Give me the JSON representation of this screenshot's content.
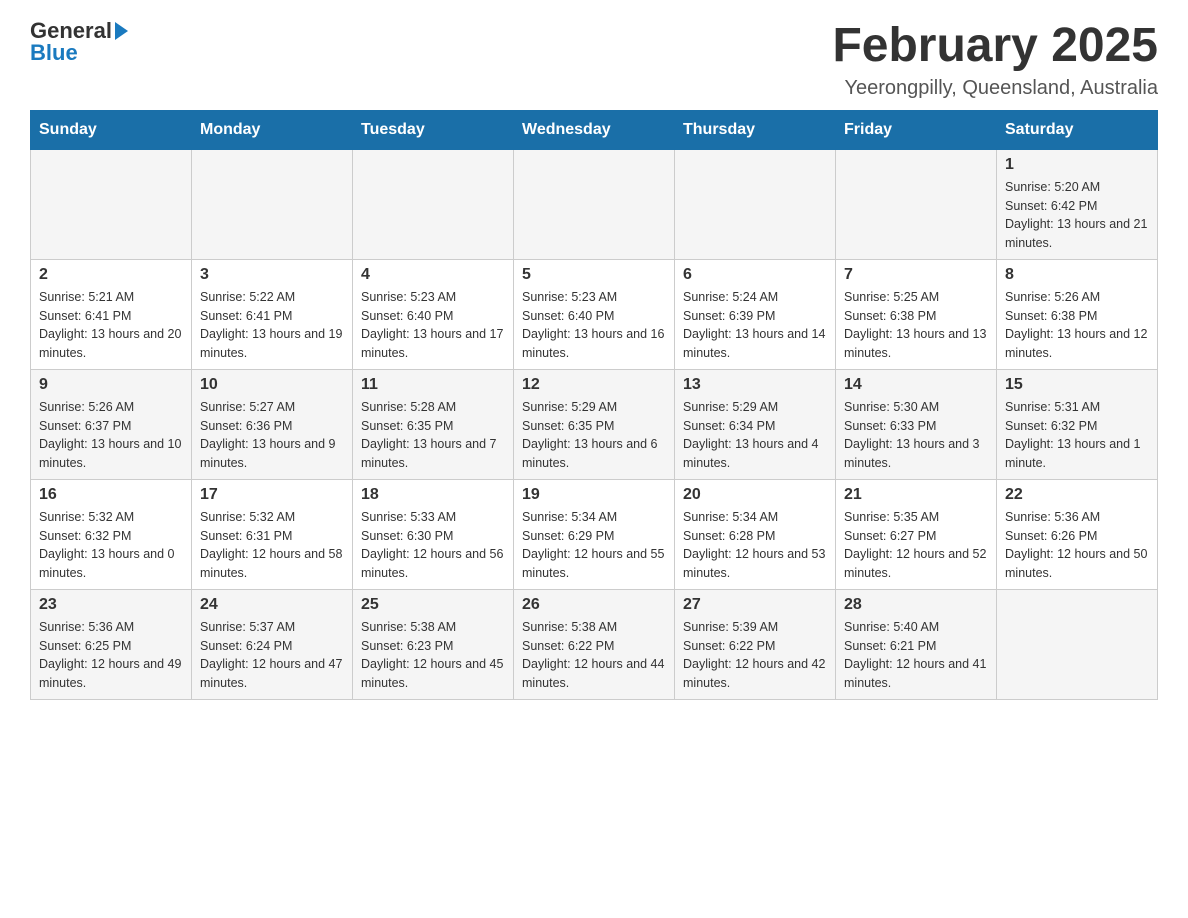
{
  "header": {
    "logo": {
      "general": "General",
      "blue": "Blue"
    },
    "title": "February 2025",
    "location": "Yeerongpilly, Queensland, Australia"
  },
  "days_of_week": [
    "Sunday",
    "Monday",
    "Tuesday",
    "Wednesday",
    "Thursday",
    "Friday",
    "Saturday"
  ],
  "weeks": [
    {
      "row": 1,
      "days": [
        {
          "date": "",
          "info": ""
        },
        {
          "date": "",
          "info": ""
        },
        {
          "date": "",
          "info": ""
        },
        {
          "date": "",
          "info": ""
        },
        {
          "date": "",
          "info": ""
        },
        {
          "date": "",
          "info": ""
        },
        {
          "date": "1",
          "info": "Sunrise: 5:20 AM\nSunset: 6:42 PM\nDaylight: 13 hours and 21 minutes."
        }
      ]
    },
    {
      "row": 2,
      "days": [
        {
          "date": "2",
          "info": "Sunrise: 5:21 AM\nSunset: 6:41 PM\nDaylight: 13 hours and 20 minutes."
        },
        {
          "date": "3",
          "info": "Sunrise: 5:22 AM\nSunset: 6:41 PM\nDaylight: 13 hours and 19 minutes."
        },
        {
          "date": "4",
          "info": "Sunrise: 5:23 AM\nSunset: 6:40 PM\nDaylight: 13 hours and 17 minutes."
        },
        {
          "date": "5",
          "info": "Sunrise: 5:23 AM\nSunset: 6:40 PM\nDaylight: 13 hours and 16 minutes."
        },
        {
          "date": "6",
          "info": "Sunrise: 5:24 AM\nSunset: 6:39 PM\nDaylight: 13 hours and 14 minutes."
        },
        {
          "date": "7",
          "info": "Sunrise: 5:25 AM\nSunset: 6:38 PM\nDaylight: 13 hours and 13 minutes."
        },
        {
          "date": "8",
          "info": "Sunrise: 5:26 AM\nSunset: 6:38 PM\nDaylight: 13 hours and 12 minutes."
        }
      ]
    },
    {
      "row": 3,
      "days": [
        {
          "date": "9",
          "info": "Sunrise: 5:26 AM\nSunset: 6:37 PM\nDaylight: 13 hours and 10 minutes."
        },
        {
          "date": "10",
          "info": "Sunrise: 5:27 AM\nSunset: 6:36 PM\nDaylight: 13 hours and 9 minutes."
        },
        {
          "date": "11",
          "info": "Sunrise: 5:28 AM\nSunset: 6:35 PM\nDaylight: 13 hours and 7 minutes."
        },
        {
          "date": "12",
          "info": "Sunrise: 5:29 AM\nSunset: 6:35 PM\nDaylight: 13 hours and 6 minutes."
        },
        {
          "date": "13",
          "info": "Sunrise: 5:29 AM\nSunset: 6:34 PM\nDaylight: 13 hours and 4 minutes."
        },
        {
          "date": "14",
          "info": "Sunrise: 5:30 AM\nSunset: 6:33 PM\nDaylight: 13 hours and 3 minutes."
        },
        {
          "date": "15",
          "info": "Sunrise: 5:31 AM\nSunset: 6:32 PM\nDaylight: 13 hours and 1 minute."
        }
      ]
    },
    {
      "row": 4,
      "days": [
        {
          "date": "16",
          "info": "Sunrise: 5:32 AM\nSunset: 6:32 PM\nDaylight: 13 hours and 0 minutes."
        },
        {
          "date": "17",
          "info": "Sunrise: 5:32 AM\nSunset: 6:31 PM\nDaylight: 12 hours and 58 minutes."
        },
        {
          "date": "18",
          "info": "Sunrise: 5:33 AM\nSunset: 6:30 PM\nDaylight: 12 hours and 56 minutes."
        },
        {
          "date": "19",
          "info": "Sunrise: 5:34 AM\nSunset: 6:29 PM\nDaylight: 12 hours and 55 minutes."
        },
        {
          "date": "20",
          "info": "Sunrise: 5:34 AM\nSunset: 6:28 PM\nDaylight: 12 hours and 53 minutes."
        },
        {
          "date": "21",
          "info": "Sunrise: 5:35 AM\nSunset: 6:27 PM\nDaylight: 12 hours and 52 minutes."
        },
        {
          "date": "22",
          "info": "Sunrise: 5:36 AM\nSunset: 6:26 PM\nDaylight: 12 hours and 50 minutes."
        }
      ]
    },
    {
      "row": 5,
      "days": [
        {
          "date": "23",
          "info": "Sunrise: 5:36 AM\nSunset: 6:25 PM\nDaylight: 12 hours and 49 minutes."
        },
        {
          "date": "24",
          "info": "Sunrise: 5:37 AM\nSunset: 6:24 PM\nDaylight: 12 hours and 47 minutes."
        },
        {
          "date": "25",
          "info": "Sunrise: 5:38 AM\nSunset: 6:23 PM\nDaylight: 12 hours and 45 minutes."
        },
        {
          "date": "26",
          "info": "Sunrise: 5:38 AM\nSunset: 6:22 PM\nDaylight: 12 hours and 44 minutes."
        },
        {
          "date": "27",
          "info": "Sunrise: 5:39 AM\nSunset: 6:22 PM\nDaylight: 12 hours and 42 minutes."
        },
        {
          "date": "28",
          "info": "Sunrise: 5:40 AM\nSunset: 6:21 PM\nDaylight: 12 hours and 41 minutes."
        },
        {
          "date": "",
          "info": ""
        }
      ]
    }
  ]
}
